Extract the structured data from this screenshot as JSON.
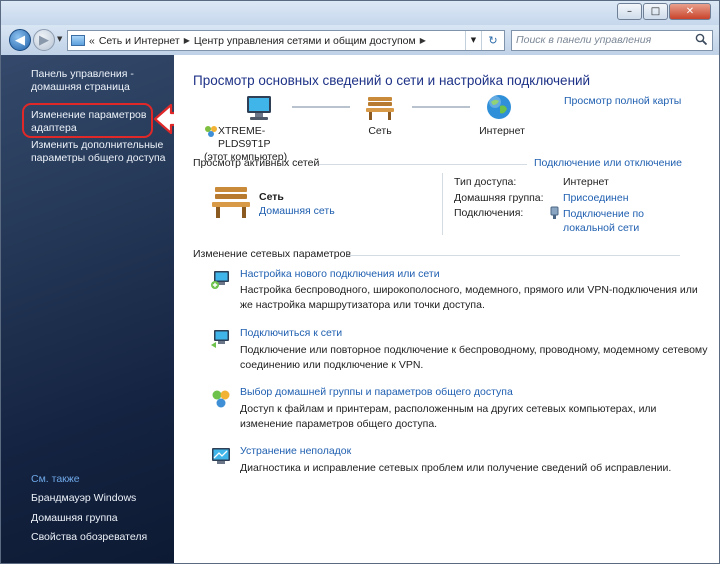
{
  "titlebar": {
    "minimize": "–",
    "maximize": "□",
    "close": "✕"
  },
  "navbar": {
    "back_icon": "arrow-left-icon",
    "forward_icon": "arrow-right-icon",
    "breadcrumbs": [
      "Сеть и Интернет",
      "Центр управления сетями и общим доступом"
    ],
    "crumb_prefix": "«",
    "search_placeholder": "Поиск в панели управления"
  },
  "sidebar": {
    "items": [
      {
        "label": "Панель управления - домашняя страница"
      },
      {
        "label": "Изменение параметров адаптера"
      },
      {
        "label": "Изменить дополнительные параметры общего доступа"
      }
    ],
    "see_also_heading": "См. также",
    "see_also": [
      {
        "label": "Брандмауэр Windows"
      },
      {
        "label": "Домашняя группа"
      },
      {
        "label": "Свойства обозревателя"
      }
    ],
    "highlight_color": "#e02828"
  },
  "main": {
    "title": "Просмотр основных сведений о сети и настройка подключений",
    "full_map_link": "Просмотр полной карты",
    "network_map": {
      "computer_name": "XTREME-PLDS9T1P",
      "computer_sub": "(этот компьютер)",
      "network_label": "Сеть",
      "internet_label": "Интернет"
    },
    "active_networks": {
      "heading": "Просмотр активных сетей",
      "connect_link": "Подключение или отключение",
      "network_name": "Сеть",
      "network_type": "Домашняя сеть",
      "access_type_label": "Тип доступа:",
      "access_type_value": "Интернет",
      "homegroup_label": "Домашняя группа:",
      "homegroup_value": "Присоединен",
      "connections_label": "Подключения:",
      "connections_value": "Подключение по локальной сети"
    },
    "change_settings": {
      "heading": "Изменение сетевых параметров",
      "tasks": [
        {
          "title": "Настройка нового подключения или сети",
          "desc": "Настройка беспроводного, широкополосного, модемного, прямого или VPN-подключения или же настройка маршрутизатора или точки доступа.",
          "icon": "new-connection-icon"
        },
        {
          "title": "Подключиться к сети",
          "desc": "Подключение или повторное подключение к беспроводному, проводному, модемному сетевому соединению или подключение к VPN.",
          "icon": "connect-network-icon"
        },
        {
          "title": "Выбор домашней группы и параметров общего доступа",
          "desc": "Доступ к файлам и принтерам, расположенным на других сетевых компьютерах, или изменение параметров общего доступа.",
          "icon": "homegroup-icon"
        },
        {
          "title": "Устранение неполадок",
          "desc": "Диагностика и исправление сетевых проблем или получение сведений об исправлении.",
          "icon": "troubleshoot-icon"
        }
      ]
    }
  }
}
